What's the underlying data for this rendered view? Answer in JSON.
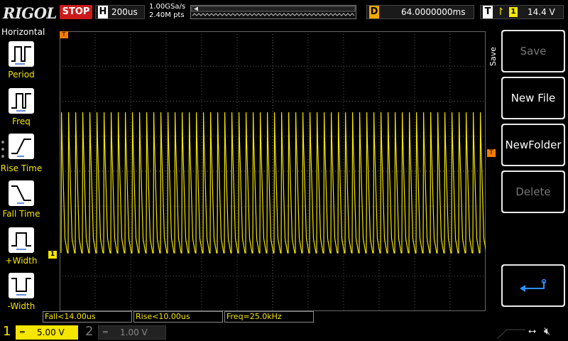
{
  "topbar": {
    "logo": "RIGOL",
    "run_state": "STOP",
    "horizontal_letter": "H",
    "timebase": "200us",
    "sample_rate": "1.00GSa/s",
    "memory_depth": "2.40M pts",
    "delay_letter": "D",
    "delay": "64.0000000ms",
    "trigger_letter": "T",
    "trigger_source": "1",
    "trigger_level": "14.4 V"
  },
  "left_menu": {
    "title": "Horizontal",
    "items": [
      {
        "label": "Period",
        "icon": "period-icon"
      },
      {
        "label": "Freq",
        "icon": "frequency-icon"
      },
      {
        "label": "Rise Time",
        "icon": "rise-time-icon"
      },
      {
        "label": "Fall Time",
        "icon": "fall-time-icon"
      },
      {
        "label": "+Width",
        "icon": "positive-width-icon"
      },
      {
        "label": "-Width",
        "icon": "negative-width-icon"
      }
    ]
  },
  "right_menu": {
    "side_label": "Save",
    "buttons": [
      {
        "label": "Save",
        "enabled": false
      },
      {
        "label": "New File",
        "enabled": true
      },
      {
        "label": "NewFolder",
        "enabled": true
      },
      {
        "label": "Delete",
        "enabled": false
      },
      {
        "label": "",
        "icon": "enter-return-icon",
        "enabled": true
      }
    ]
  },
  "measurements": [
    {
      "text": "Fall<14.00us"
    },
    {
      "text": "Rise<10.00us"
    },
    {
      "text": "Freq=25.0kHz"
    }
  ],
  "channels": {
    "ch1": {
      "number": "1",
      "scale": "5.00 V",
      "coupling_icon": "dc-coupling-icon"
    },
    "ch2": {
      "number": "2",
      "scale": "1.00 V",
      "coupling_icon": "dc-coupling-icon"
    }
  },
  "markers": {
    "trigger_position_marker": "T",
    "channel1_ground_marker": "1",
    "trigger_level_marker": "T"
  },
  "colors": {
    "ch1": "#f5e600",
    "stop": "#cc1a1a",
    "delay_accent": "#f2a900",
    "trigger_marker": "#f57c00"
  },
  "waveform": {
    "frequency_khz": 25.0,
    "cycles_on_screen": 60
  }
}
